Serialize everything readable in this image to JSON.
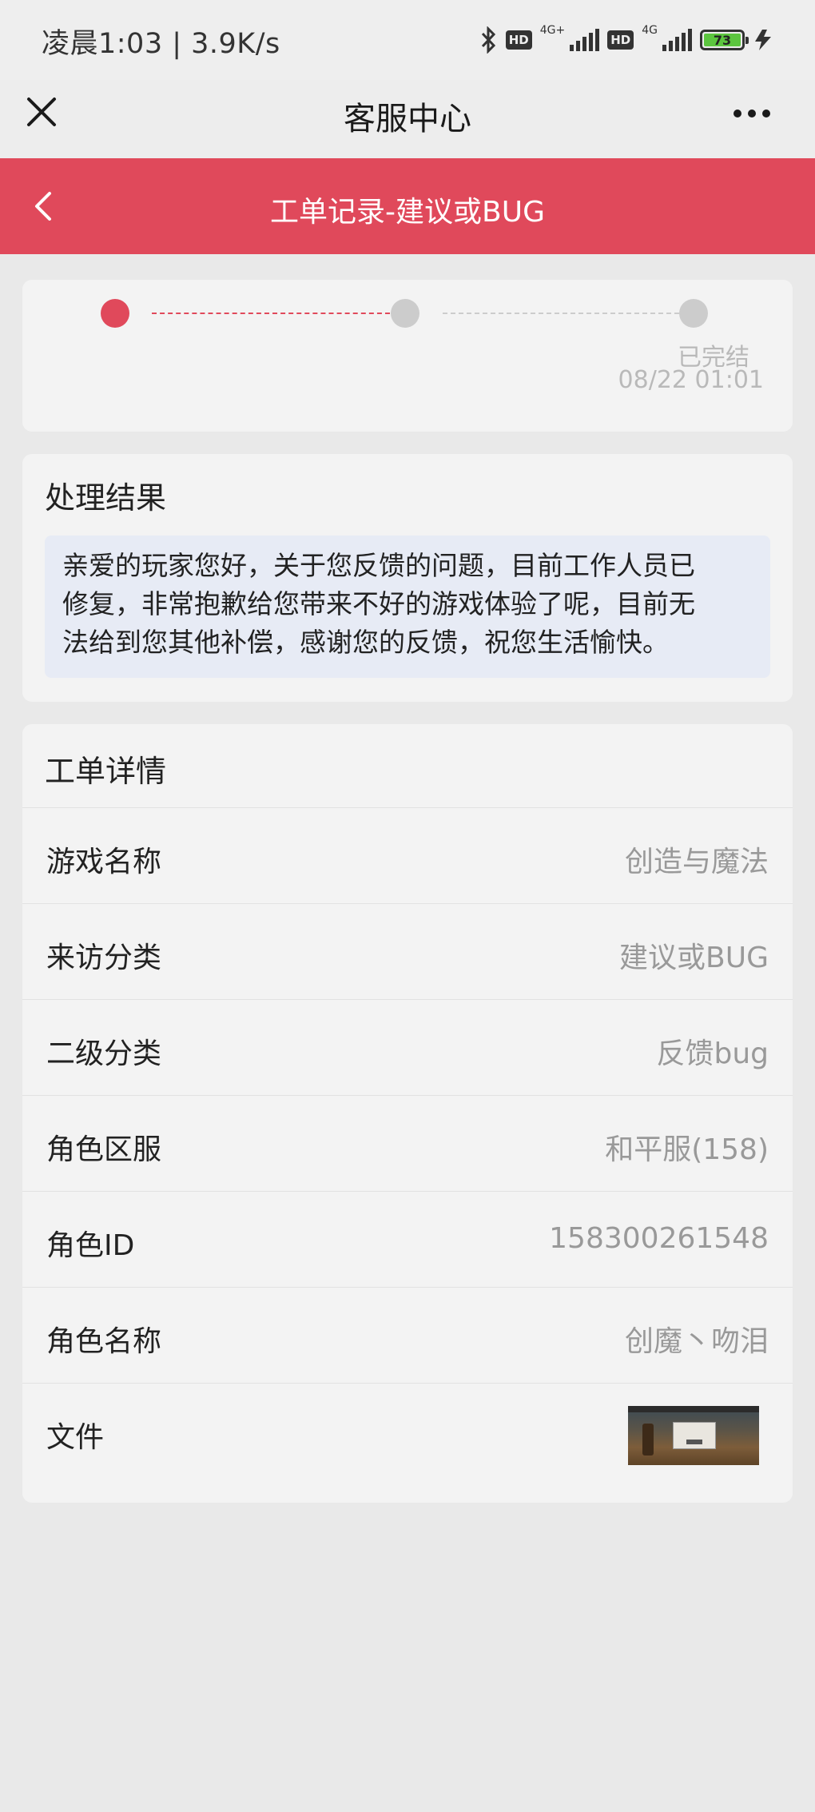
{
  "status_bar": {
    "time": "凌晨1:03 | 3.9K/s",
    "sim1_type": "4G+",
    "sim2_type": "4G",
    "hd_label": "HD",
    "battery_level": "73",
    "battery_color": "#5cc53f"
  },
  "wechat_nav": {
    "title": "客服中心"
  },
  "page_header": {
    "title": "工单记录-建议或BUG",
    "background_color": "#e0495b"
  },
  "progress": {
    "steps": 3,
    "current_step": 1,
    "final_status": "已完结",
    "final_date": "08/22 01:01",
    "active_color": "#e0495b",
    "inactive_color": "#cccccc"
  },
  "result": {
    "title": "处理结果",
    "line1": "亲爱的玩家您好，关于您反馈的问题，目前工作人员已",
    "line2": "修复，非常抱歉给您带来不好的游戏体验了呢，目前无",
    "line3": "法给到您其他补偿，感谢您的反馈，祝您生活愉快。"
  },
  "details": {
    "title": "工单详情",
    "rows": [
      {
        "label": "游戏名称",
        "value": "创造与魔法"
      },
      {
        "label": "来访分类",
        "value": "建议或BUG"
      },
      {
        "label": "二级分类",
        "value": "反馈bug"
      },
      {
        "label": "角色区服",
        "value": "和平服(158)"
      },
      {
        "label": "角色ID",
        "value": "158300261548"
      },
      {
        "label": "角色名称",
        "value": "创魔丶吻泪"
      }
    ],
    "file_label": "文件"
  }
}
